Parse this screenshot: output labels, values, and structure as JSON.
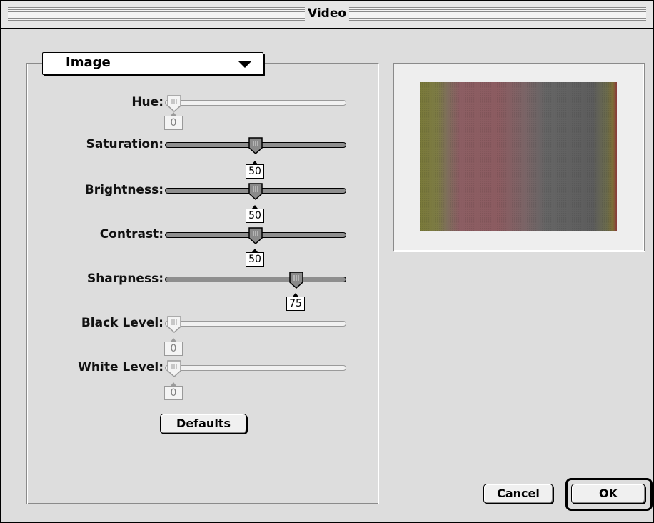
{
  "window": {
    "title": "Video"
  },
  "popup": {
    "label": "Image"
  },
  "sliders": [
    {
      "label": "Hue:",
      "value": "0",
      "fraction": 0.0,
      "enabled": false
    },
    {
      "label": "Saturation:",
      "value": "50",
      "fraction": 0.5,
      "enabled": true
    },
    {
      "label": "Brightness:",
      "value": "50",
      "fraction": 0.5,
      "enabled": true
    },
    {
      "label": "Contrast:",
      "value": "50",
      "fraction": 0.5,
      "enabled": true
    },
    {
      "label": "Sharpness:",
      "value": "75",
      "fraction": 0.75,
      "enabled": true
    },
    {
      "label": "Black Level:",
      "value": "0",
      "fraction": 0.0,
      "enabled": false
    },
    {
      "label": "White Level:",
      "value": "0",
      "fraction": 0.0,
      "enabled": false
    }
  ],
  "buttons": {
    "defaults": "Defaults",
    "cancel": "Cancel",
    "ok": "OK"
  }
}
